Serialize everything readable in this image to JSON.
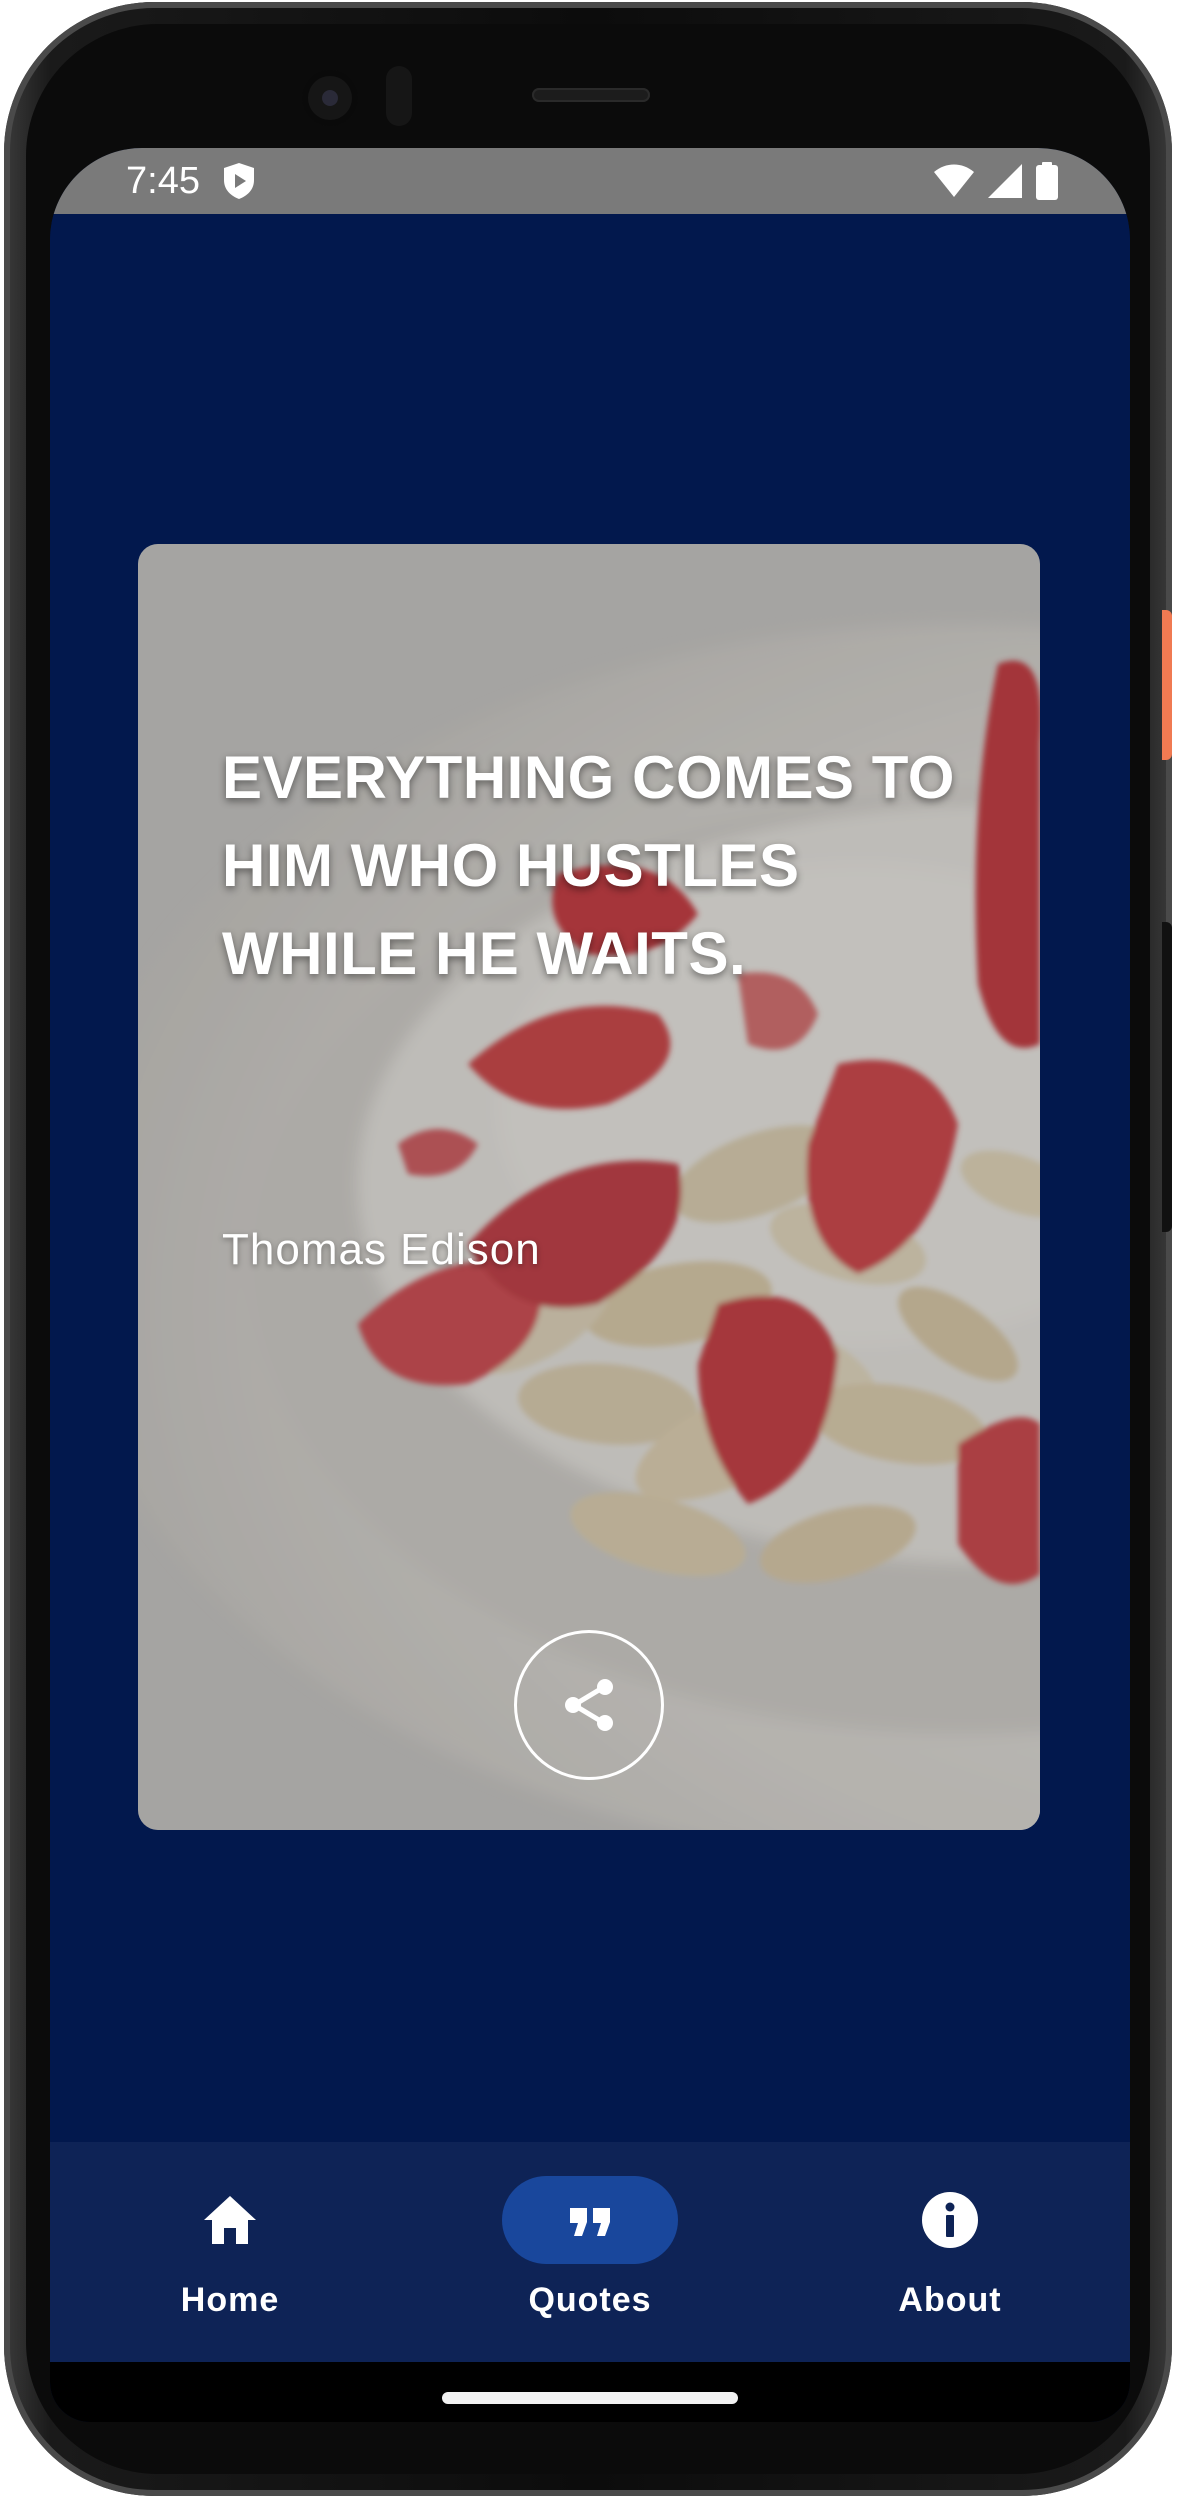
{
  "status_bar": {
    "time": "7:45",
    "icons": [
      "shield-icon",
      "wifi-icon",
      "cellular-signal-icon",
      "battery-icon"
    ]
  },
  "quote_card": {
    "quote": "EVERYTHING COMES TO HIM WHO HUSTLES WHILE HE WAITS.",
    "author": "Thomas Edison",
    "share_icon": "share-icon"
  },
  "bottom_nav": {
    "items": [
      {
        "label": "Home",
        "icon": "home-icon",
        "active": false
      },
      {
        "label": "Quotes",
        "icon": "quote-icon",
        "active": true
      },
      {
        "label": "About",
        "icon": "info-icon",
        "active": false
      }
    ]
  },
  "colors": {
    "background": "#02184d",
    "nav_background": "#0e2356",
    "nav_active_pill": "#19479c",
    "status_bar": "#7a7a7a",
    "text": "#ffffff"
  }
}
